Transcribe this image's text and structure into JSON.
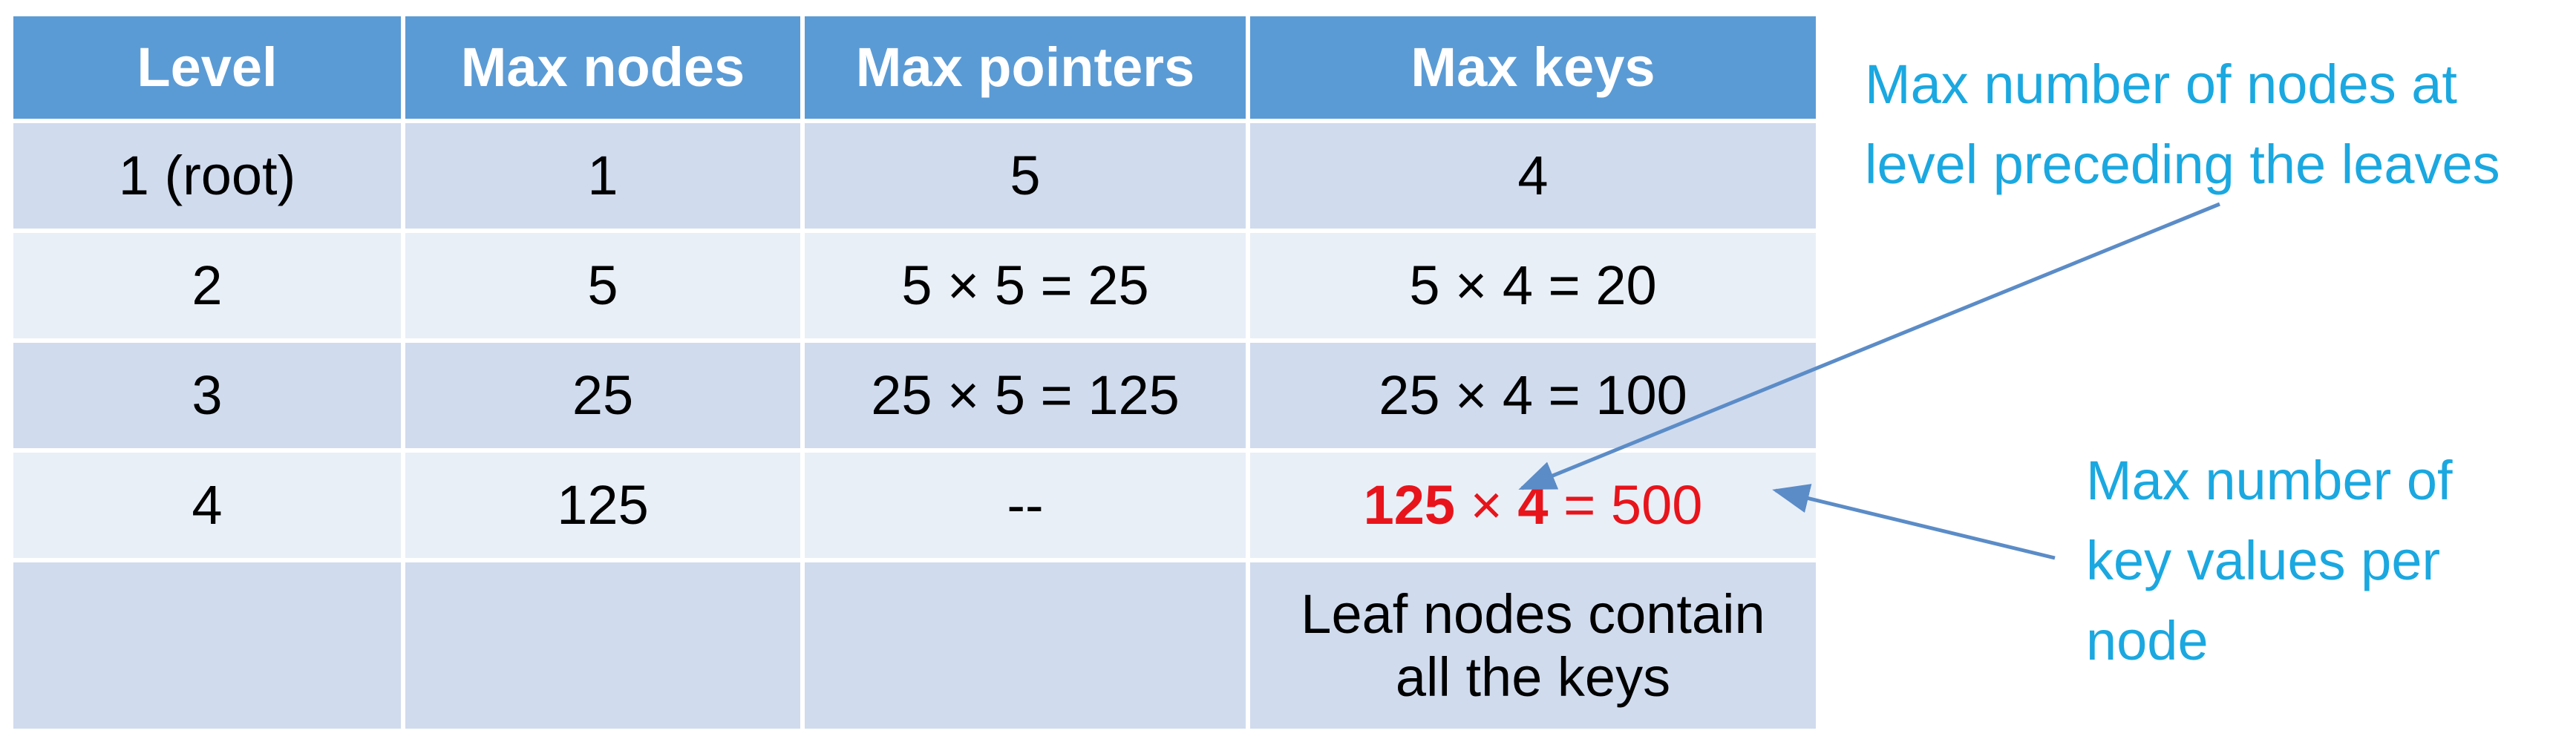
{
  "table": {
    "headers": [
      "Level",
      "Max nodes",
      "Max pointers",
      "Max keys"
    ],
    "rows": [
      {
        "level": "1 (root)",
        "max_nodes": "1",
        "max_pointers": "5",
        "max_keys": "4"
      },
      {
        "level": "2",
        "max_nodes": "5",
        "max_pointers": "5 × 5 = 25",
        "max_keys": "5 × 4 = 20"
      },
      {
        "level": "3",
        "max_nodes": "25",
        "max_pointers": "25 × 5 = 125",
        "max_keys": "25 × 4 = 100"
      },
      {
        "level": "4",
        "max_nodes": "125",
        "max_pointers": "--",
        "max_keys_parts": {
          "nodes": "125",
          "times": " × ",
          "keys_per_node": "4",
          "result": " = 500"
        }
      },
      {
        "level": "",
        "max_nodes": "",
        "max_pointers": "",
        "max_keys_note": {
          "line1": "Leaf nodes contain",
          "line2": "all the keys"
        }
      }
    ]
  },
  "annotations": {
    "top": {
      "line1": "Max number of nodes at",
      "line2": "level preceding the leaves"
    },
    "right": {
      "line1": "Max number of",
      "line2": "key values per",
      "line3": "node"
    }
  },
  "colors": {
    "header_bg": "#5b9bd5",
    "row_dark": "#d0dbee",
    "row_light": "#e9eff7",
    "highlight": "#e8141b",
    "annotation_text": "#1ba8e0",
    "arrow": "#5b8cc7"
  }
}
